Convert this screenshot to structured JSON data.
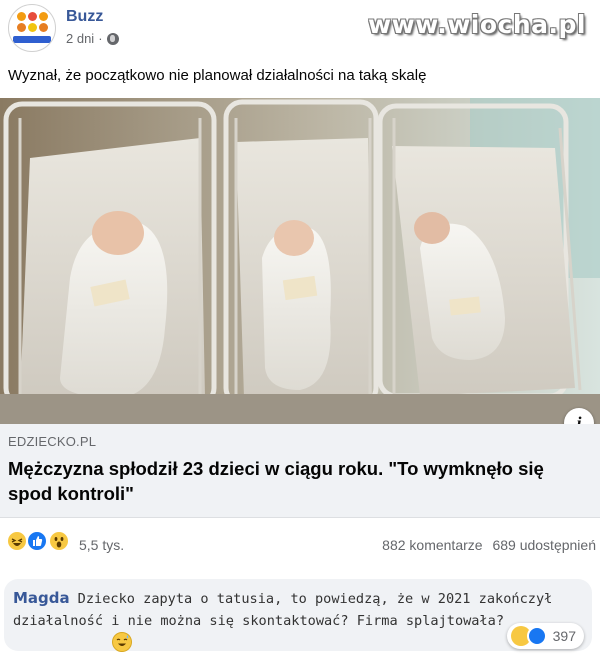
{
  "post": {
    "author": "Buzz",
    "time": "2 dni",
    "separator": "·",
    "privacy_icon": "globe-icon",
    "caption": "Wyznał, że początkowo nie planował działalności na taką skalę",
    "watermark": "www.wiocha.pl"
  },
  "link_preview": {
    "domain": "EDZIECKO.PL",
    "headline": "Mężczyzna spłodził 23 dzieci w ciągu roku. \"To wymknęło się spod kontroli\"",
    "info_icon": "i"
  },
  "reactions": {
    "icons": [
      "haha-reaction-icon",
      "like-reaction-icon",
      "wow-reaction-icon"
    ],
    "total": "5,5 tys.",
    "comments": "882 komentarze",
    "shares": "689 udostępnień"
  },
  "comment": {
    "author": "Magda",
    "text": "Dziecko zapyta o tatusia, to powiedzą, że w 2021 zakończył działalność i nie można się skontaktować? Firma splajtowała?",
    "reaction_count": "397",
    "reaction_icons": [
      "haha-reaction-icon",
      "like-reaction-icon"
    ]
  },
  "colors": {
    "link_blue": "#385898",
    "muted": "#65676b",
    "like_blue": "#1877f2",
    "emoji_yellow": "#f7c842",
    "preview_bg": "#f0f2f5"
  }
}
